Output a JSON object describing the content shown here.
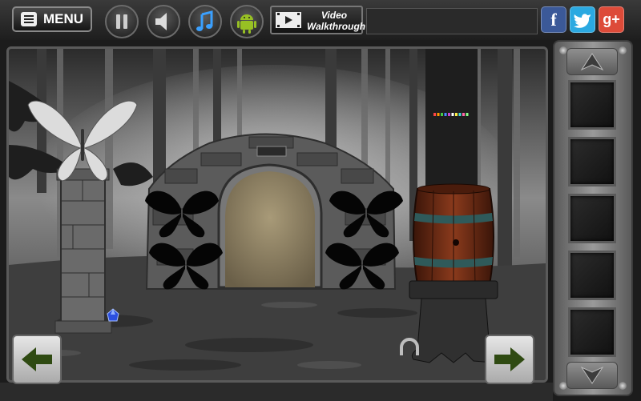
{
  "toolbar": {
    "menu_label": "MENU",
    "video_label_line1": "Video",
    "video_label_line2": "Walkthrough",
    "pause_icon": "pause-icon",
    "sound_icon": "speaker-icon",
    "music_icon": "music-note-icon",
    "android_icon": "android-icon"
  },
  "social": {
    "facebook": "f",
    "google_plus": "g+"
  },
  "colors": {
    "facebook": "#3b5998",
    "twitter": "#2ba9e1",
    "google_plus": "#dd4b39",
    "nav_arrow": "#2f4a12"
  },
  "scene": {
    "pin_colors": [
      "#ff4444",
      "#ff9900",
      "#44cc44",
      "#4488ff",
      "#cc44cc",
      "#ffffff",
      "#ffee44",
      "#44dddd",
      "#ff66aa",
      "#88ff88"
    ]
  },
  "inventory": {
    "slot_count": 5
  }
}
